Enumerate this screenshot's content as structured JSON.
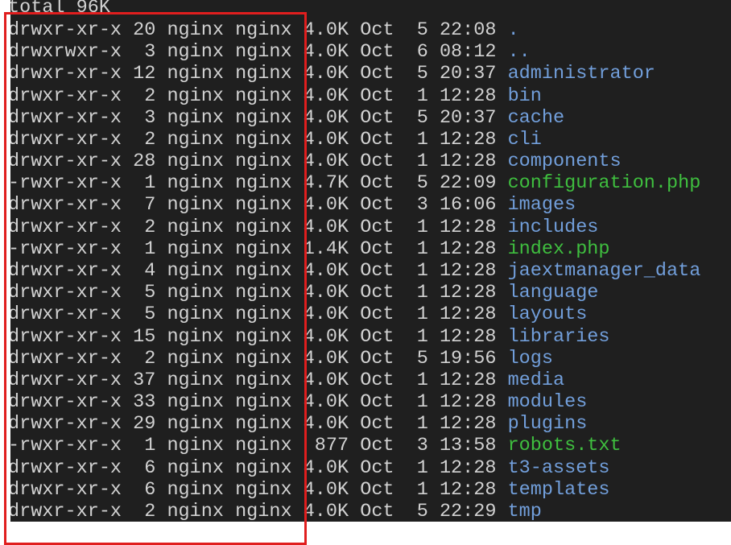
{
  "terminal": {
    "total_line": "total 96K",
    "colors": {
      "background": "#1f1f1f",
      "text": "#d2d2d2",
      "directory": "#729fdb",
      "executable": "#3fbf3f",
      "highlight_box": "#e01e1e"
    },
    "entries": [
      {
        "perms": "drwxr-xr-x",
        "links": "20",
        "owner": "nginx",
        "group": "nginx",
        "size": "4.0K",
        "month": "Oct",
        "day": "5",
        "time": "22:08",
        "name": ".",
        "type": "dir"
      },
      {
        "perms": "drwxrwxr-x",
        "links": "3",
        "owner": "nginx",
        "group": "nginx",
        "size": "4.0K",
        "month": "Oct",
        "day": "6",
        "time": "08:12",
        "name": "..",
        "type": "dir"
      },
      {
        "perms": "drwxr-xr-x",
        "links": "12",
        "owner": "nginx",
        "group": "nginx",
        "size": "4.0K",
        "month": "Oct",
        "day": "5",
        "time": "20:37",
        "name": "administrator",
        "type": "dir"
      },
      {
        "perms": "drwxr-xr-x",
        "links": "2",
        "owner": "nginx",
        "group": "nginx",
        "size": "4.0K",
        "month": "Oct",
        "day": "1",
        "time": "12:28",
        "name": "bin",
        "type": "dir"
      },
      {
        "perms": "drwxr-xr-x",
        "links": "3",
        "owner": "nginx",
        "group": "nginx",
        "size": "4.0K",
        "month": "Oct",
        "day": "5",
        "time": "20:37",
        "name": "cache",
        "type": "dir"
      },
      {
        "perms": "drwxr-xr-x",
        "links": "2",
        "owner": "nginx",
        "group": "nginx",
        "size": "4.0K",
        "month": "Oct",
        "day": "1",
        "time": "12:28",
        "name": "cli",
        "type": "dir"
      },
      {
        "perms": "drwxr-xr-x",
        "links": "28",
        "owner": "nginx",
        "group": "nginx",
        "size": "4.0K",
        "month": "Oct",
        "day": "1",
        "time": "12:28",
        "name": "components",
        "type": "dir"
      },
      {
        "perms": "-rwxr-xr-x",
        "links": "1",
        "owner": "nginx",
        "group": "nginx",
        "size": "4.7K",
        "month": "Oct",
        "day": "5",
        "time": "22:09",
        "name": "configuration.php",
        "type": "exe"
      },
      {
        "perms": "drwxr-xr-x",
        "links": "7",
        "owner": "nginx",
        "group": "nginx",
        "size": "4.0K",
        "month": "Oct",
        "day": "3",
        "time": "16:06",
        "name": "images",
        "type": "dir"
      },
      {
        "perms": "drwxr-xr-x",
        "links": "2",
        "owner": "nginx",
        "group": "nginx",
        "size": "4.0K",
        "month": "Oct",
        "day": "1",
        "time": "12:28",
        "name": "includes",
        "type": "dir"
      },
      {
        "perms": "-rwxr-xr-x",
        "links": "1",
        "owner": "nginx",
        "group": "nginx",
        "size": "1.4K",
        "month": "Oct",
        "day": "1",
        "time": "12:28",
        "name": "index.php",
        "type": "exe"
      },
      {
        "perms": "drwxr-xr-x",
        "links": "4",
        "owner": "nginx",
        "group": "nginx",
        "size": "4.0K",
        "month": "Oct",
        "day": "1",
        "time": "12:28",
        "name": "jaextmanager_data",
        "type": "dir"
      },
      {
        "perms": "drwxr-xr-x",
        "links": "5",
        "owner": "nginx",
        "group": "nginx",
        "size": "4.0K",
        "month": "Oct",
        "day": "1",
        "time": "12:28",
        "name": "language",
        "type": "dir"
      },
      {
        "perms": "drwxr-xr-x",
        "links": "5",
        "owner": "nginx",
        "group": "nginx",
        "size": "4.0K",
        "month": "Oct",
        "day": "1",
        "time": "12:28",
        "name": "layouts",
        "type": "dir"
      },
      {
        "perms": "drwxr-xr-x",
        "links": "15",
        "owner": "nginx",
        "group": "nginx",
        "size": "4.0K",
        "month": "Oct",
        "day": "1",
        "time": "12:28",
        "name": "libraries",
        "type": "dir"
      },
      {
        "perms": "drwxr-xr-x",
        "links": "2",
        "owner": "nginx",
        "group": "nginx",
        "size": "4.0K",
        "month": "Oct",
        "day": "5",
        "time": "19:56",
        "name": "logs",
        "type": "dir"
      },
      {
        "perms": "drwxr-xr-x",
        "links": "37",
        "owner": "nginx",
        "group": "nginx",
        "size": "4.0K",
        "month": "Oct",
        "day": "1",
        "time": "12:28",
        "name": "media",
        "type": "dir"
      },
      {
        "perms": "drwxr-xr-x",
        "links": "33",
        "owner": "nginx",
        "group": "nginx",
        "size": "4.0K",
        "month": "Oct",
        "day": "1",
        "time": "12:28",
        "name": "modules",
        "type": "dir"
      },
      {
        "perms": "drwxr-xr-x",
        "links": "29",
        "owner": "nginx",
        "group": "nginx",
        "size": "4.0K",
        "month": "Oct",
        "day": "1",
        "time": "12:28",
        "name": "plugins",
        "type": "dir"
      },
      {
        "perms": "-rwxr-xr-x",
        "links": "1",
        "owner": "nginx",
        "group": "nginx",
        "size": "877",
        "month": "Oct",
        "day": "3",
        "time": "13:58",
        "name": "robots.txt",
        "type": "exe"
      },
      {
        "perms": "drwxr-xr-x",
        "links": "6",
        "owner": "nginx",
        "group": "nginx",
        "size": "4.0K",
        "month": "Oct",
        "day": "1",
        "time": "12:28",
        "name": "t3-assets",
        "type": "dir"
      },
      {
        "perms": "drwxr-xr-x",
        "links": "6",
        "owner": "nginx",
        "group": "nginx",
        "size": "4.0K",
        "month": "Oct",
        "day": "1",
        "time": "12:28",
        "name": "templates",
        "type": "dir"
      },
      {
        "perms": "drwxr-xr-x",
        "links": "2",
        "owner": "nginx",
        "group": "nginx",
        "size": "4.0K",
        "month": "Oct",
        "day": "5",
        "time": "22:29",
        "name": "tmp",
        "type": "dir"
      }
    ]
  }
}
